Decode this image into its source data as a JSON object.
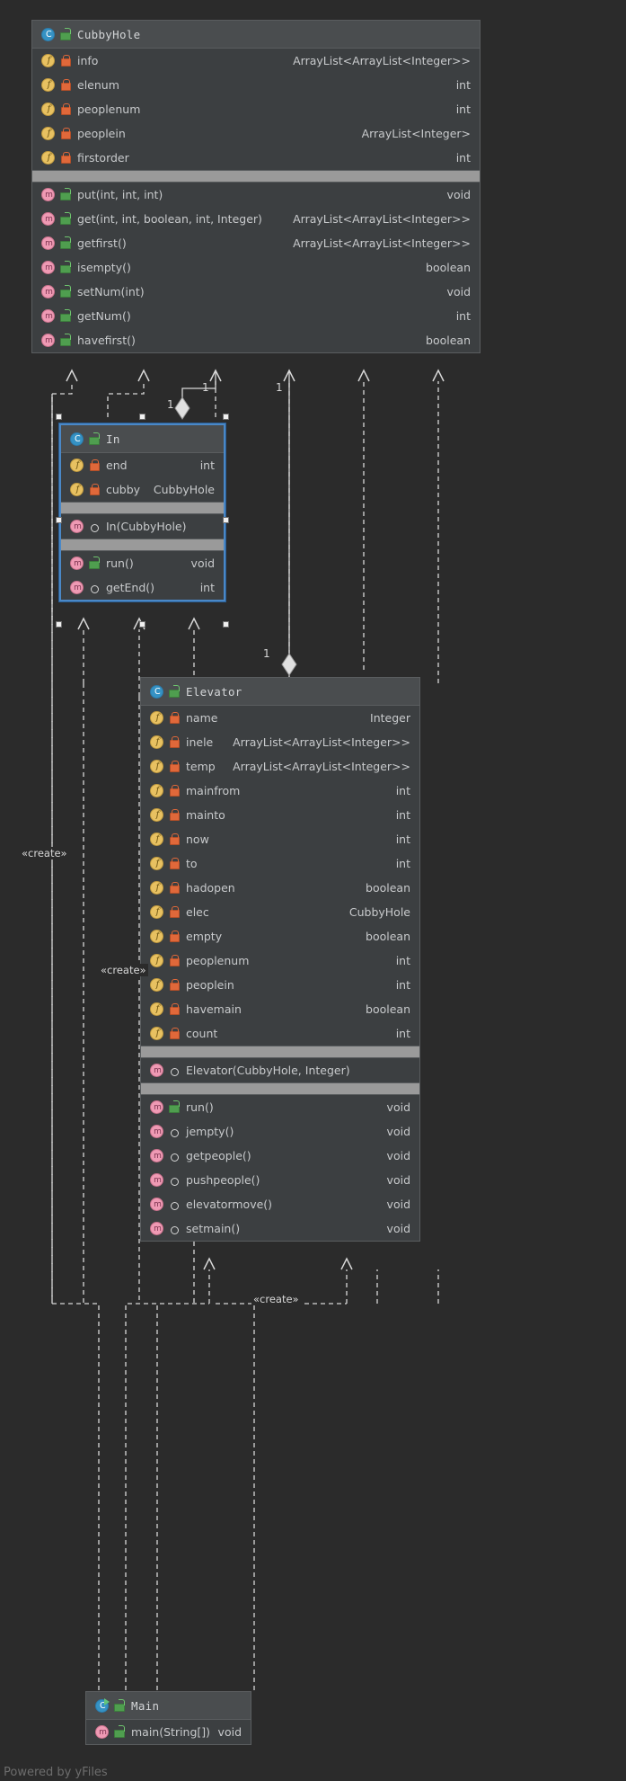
{
  "canvas": {
    "background": "#2b2b2b",
    "watermark": "Powered by yFiles"
  },
  "icons": {
    "class": "class-icon",
    "runnable_class": "runnable-class-icon",
    "field": "field-icon",
    "method": "method-icon",
    "public": "unlock-public-icon",
    "private": "lock-private-icon",
    "package": "circle-package-icon"
  },
  "classes": {
    "cubbyhole": {
      "name": "CubbyHole",
      "visibility": "public",
      "fields": [
        {
          "name": "info",
          "type": "ArrayList<ArrayList<Integer>>",
          "visibility": "private"
        },
        {
          "name": "elenum",
          "type": "int",
          "visibility": "private"
        },
        {
          "name": "peoplenum",
          "type": "int",
          "visibility": "private"
        },
        {
          "name": "peoplein",
          "type": "ArrayList<Integer>",
          "visibility": "private"
        },
        {
          "name": "firstorder",
          "type": "int",
          "visibility": "private"
        }
      ],
      "methods": [
        {
          "name": "put(int, int, int)",
          "type": "void",
          "visibility": "public"
        },
        {
          "name": "get(int, int, boolean, int, Integer)",
          "type": "ArrayList<ArrayList<Integer>>",
          "visibility": "public"
        },
        {
          "name": "getfirst()",
          "type": "ArrayList<ArrayList<Integer>>",
          "visibility": "public"
        },
        {
          "name": "isempty()",
          "type": "boolean",
          "visibility": "public"
        },
        {
          "name": "setNum(int)",
          "type": "void",
          "visibility": "public"
        },
        {
          "name": "getNum()",
          "type": "int",
          "visibility": "public"
        },
        {
          "name": "havefirst()",
          "type": "boolean",
          "visibility": "public"
        }
      ]
    },
    "in": {
      "name": "In",
      "visibility": "public",
      "selected": true,
      "fields": [
        {
          "name": "end",
          "type": "int",
          "visibility": "private"
        },
        {
          "name": "cubby",
          "type": "CubbyHole",
          "visibility": "private"
        }
      ],
      "constructors": [
        {
          "name": "In(CubbyHole)",
          "type": "",
          "visibility": "package"
        }
      ],
      "methods": [
        {
          "name": "run()",
          "type": "void",
          "visibility": "public"
        },
        {
          "name": "getEnd()",
          "type": "int",
          "visibility": "package"
        }
      ]
    },
    "elevator": {
      "name": "Elevator",
      "visibility": "public",
      "fields": [
        {
          "name": "name",
          "type": "Integer",
          "visibility": "private"
        },
        {
          "name": "inele",
          "type": "ArrayList<ArrayList<Integer>>",
          "visibility": "private"
        },
        {
          "name": "temp",
          "type": "ArrayList<ArrayList<Integer>>",
          "visibility": "private"
        },
        {
          "name": "mainfrom",
          "type": "int",
          "visibility": "private"
        },
        {
          "name": "mainto",
          "type": "int",
          "visibility": "private"
        },
        {
          "name": "now",
          "type": "int",
          "visibility": "private"
        },
        {
          "name": "to",
          "type": "int",
          "visibility": "private"
        },
        {
          "name": "hadopen",
          "type": "boolean",
          "visibility": "private"
        },
        {
          "name": "elec",
          "type": "CubbyHole",
          "visibility": "private"
        },
        {
          "name": "empty",
          "type": "boolean",
          "visibility": "private"
        },
        {
          "name": "peoplenum",
          "type": "int",
          "visibility": "private"
        },
        {
          "name": "peoplein",
          "type": "int",
          "visibility": "private"
        },
        {
          "name": "havemain",
          "type": "boolean",
          "visibility": "private"
        },
        {
          "name": "count",
          "type": "int",
          "visibility": "private"
        }
      ],
      "constructors": [
        {
          "name": "Elevator(CubbyHole, Integer)",
          "type": "",
          "visibility": "package"
        }
      ],
      "methods": [
        {
          "name": "run()",
          "type": "void",
          "visibility": "public"
        },
        {
          "name": "jempty()",
          "type": "void",
          "visibility": "package"
        },
        {
          "name": "getpeople()",
          "type": "void",
          "visibility": "package"
        },
        {
          "name": "pushpeople()",
          "type": "void",
          "visibility": "package"
        },
        {
          "name": "elevatormove()",
          "type": "void",
          "visibility": "package"
        },
        {
          "name": "setmain()",
          "type": "void",
          "visibility": "package"
        }
      ]
    },
    "main": {
      "name": "Main",
      "visibility": "public",
      "runnable": true,
      "methods": [
        {
          "name": "main(String[])",
          "type": "void",
          "visibility": "public"
        }
      ]
    }
  },
  "edge_labels": {
    "create_1": "«create»",
    "create_2": "«create»",
    "create_3": "«create»",
    "mult_in_1": "1",
    "mult_in_2": "1",
    "mult_elevator_1": "1",
    "mult_cubby_1": "1"
  }
}
